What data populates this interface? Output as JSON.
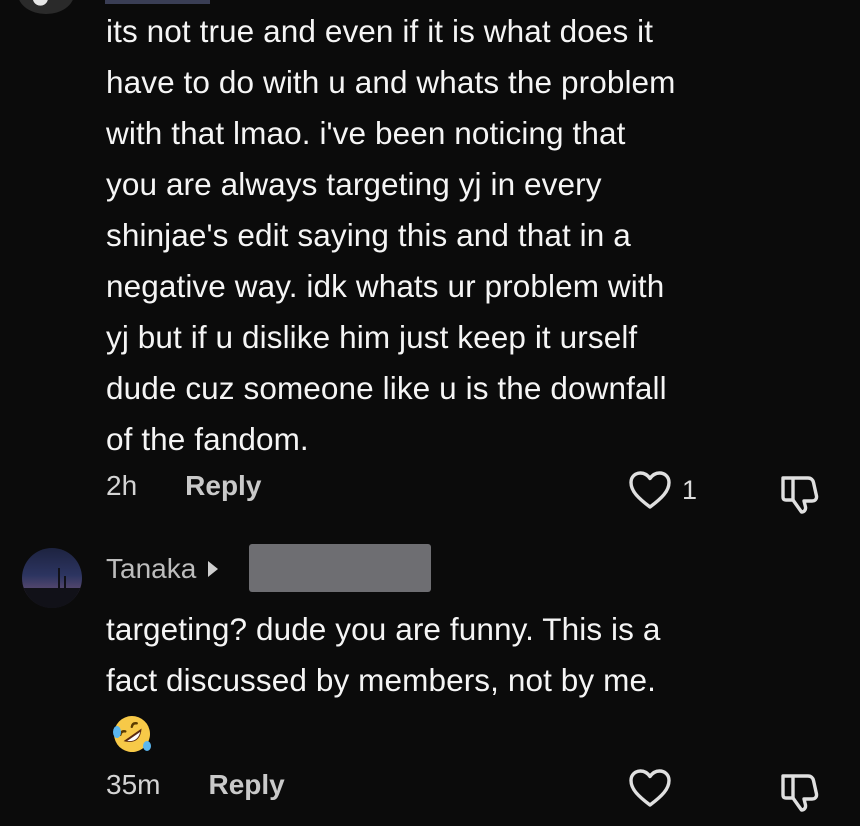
{
  "comment1": {
    "text": "its not true and even if it is what does it\nhave to do with u and whats the problem\nwith that lmao. i've been noticing that\nyou are always targeting yj in every\nshinjae's edit saying this and that in a\nnegative way. idk whats ur problem with\nyj but if u dislike him just keep it urself\ndude cuz someone like u is the downfall\nof the fandom.",
    "time": "2h",
    "reply_label": "Reply",
    "like_count": "1"
  },
  "comment2": {
    "username": "Tanaka",
    "text": "targeting? dude you are funny. This is a\nfact discussed by members, not by me.",
    "emoji": "rolling-on-floor-laughing",
    "time": "35m",
    "reply_label": "Reply"
  },
  "icons": {
    "like": "heart-outline-icon",
    "dislike": "thumbs-down-outline-icon"
  },
  "colors": {
    "background": "#0b0b0b",
    "text": "#f5f5f5",
    "meta": "#a9a9a9"
  }
}
